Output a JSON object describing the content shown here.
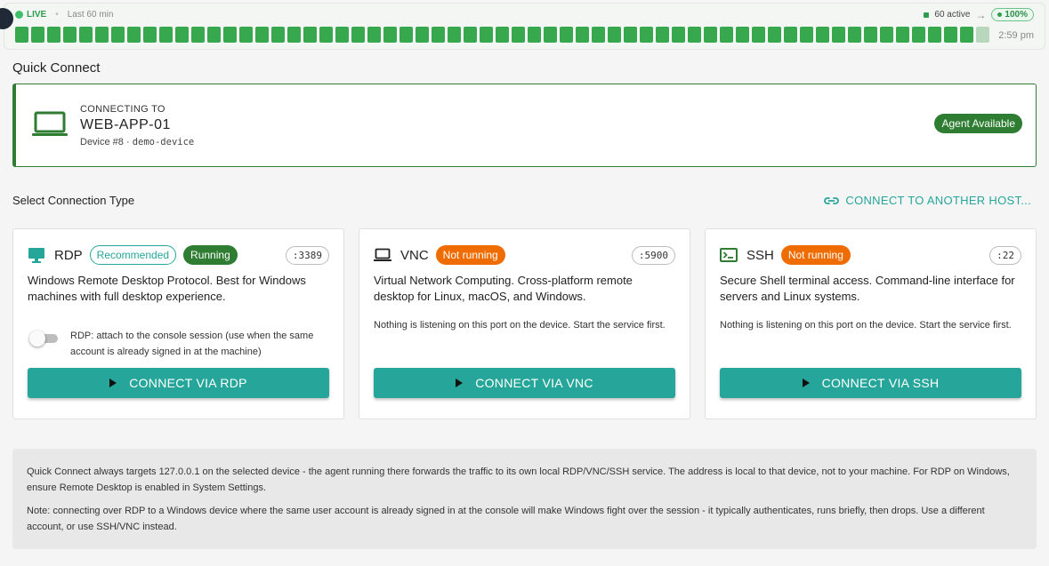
{
  "strip": {
    "live_label": "LIVE",
    "window_label": "Last 60 min",
    "active_label": "60 active",
    "arrow": "→",
    "percent": "100%",
    "time": "2:59 pm",
    "bars_ok": 60,
    "bars_pending": 1,
    "ok_color": "#38a84e",
    "pending_color": "#b7d8bd"
  },
  "quick_connect_title": "Quick Connect",
  "target": {
    "label": "CONNECTING TO",
    "host": "WEB-APP-01",
    "device_prefix": "Device #8 · ",
    "device_name": "demo-device",
    "agent_status": "Agent Available",
    "icon": "laptop-icon"
  },
  "select_title": "Select Connection Type",
  "another_host_label": "CONNECT TO ANOTHER HOST...",
  "cards": [
    {
      "name": "RDP",
      "icon": "monitor-icon",
      "recommended": "Recommended",
      "status": "Running",
      "port": ":3389",
      "description": "Windows Remote Desktop Protocol. Best for Windows machines with full desktop experience.",
      "toggle_text": "RDP: attach to the console session (use when the same account is already signed in at the machine)",
      "toggle_on": false,
      "button": "CONNECT VIA RDP"
    },
    {
      "name": "VNC",
      "icon": "laptop-icon",
      "status": "Not running",
      "port": ":5900",
      "description": "Virtual Network Computing. Cross-platform remote desktop for Linux, macOS, and Windows.",
      "note": "Nothing is listening on this port on the device. Start the service first.",
      "button": "CONNECT VIA VNC"
    },
    {
      "name": "SSH",
      "icon": "terminal-icon",
      "status": "Not running",
      "port": ":22",
      "description": "Secure Shell terminal access. Command-line interface for servers and Linux systems.",
      "note": "Nothing is listening on this port on the device. Start the service first.",
      "button": "CONNECT VIA SSH"
    }
  ],
  "info": {
    "p1": "Quick Connect always targets 127.0.0.1 on the selected device - the agent running there forwards the traffic to its own local RDP/VNC/SSH service. The address is local to that device, not to your machine. For RDP on Windows, ensure Remote Desktop is enabled in System Settings.",
    "p2": "Note: connecting over RDP to a Windows device where the same user account is already signed in at the console will make Windows fight over the session - it typically authenticates, runs briefly, then drops. Use a different account, or use SSH/VNC instead."
  },
  "colors": {
    "teal": "#26a69a",
    "green": "#2e7d32",
    "orange": "#ef6c00"
  }
}
